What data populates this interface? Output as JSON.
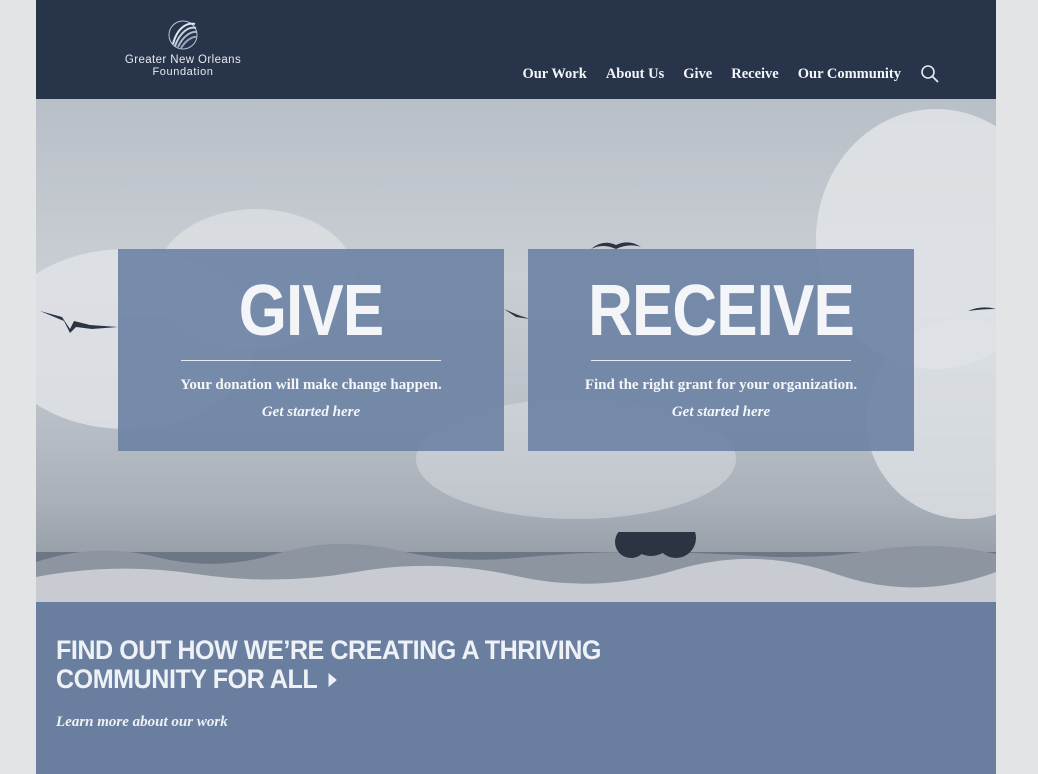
{
  "logo": {
    "line1": "Greater New Orleans",
    "line2": "Foundation"
  },
  "nav": {
    "items": [
      "Our Work",
      "About Us",
      "Give",
      "Receive",
      "Our Community"
    ],
    "search_icon": "search-icon"
  },
  "cards": {
    "give": {
      "title": "GIVE",
      "text": "Your donation will make change happen.",
      "link": "Get started here"
    },
    "receive": {
      "title": "RECEIVE",
      "text": "Find the right grant for your organization.",
      "link": "Get started here"
    }
  },
  "band": {
    "title": "FIND OUT HOW WE’RE CREATING A THRIVING COMMUNITY FOR ALL",
    "link": "Learn more about our work"
  },
  "colors": {
    "header": "#27344a",
    "card": "#6e83a5",
    "band": "#6a7f9f",
    "text_light": "#f4f6f9"
  }
}
